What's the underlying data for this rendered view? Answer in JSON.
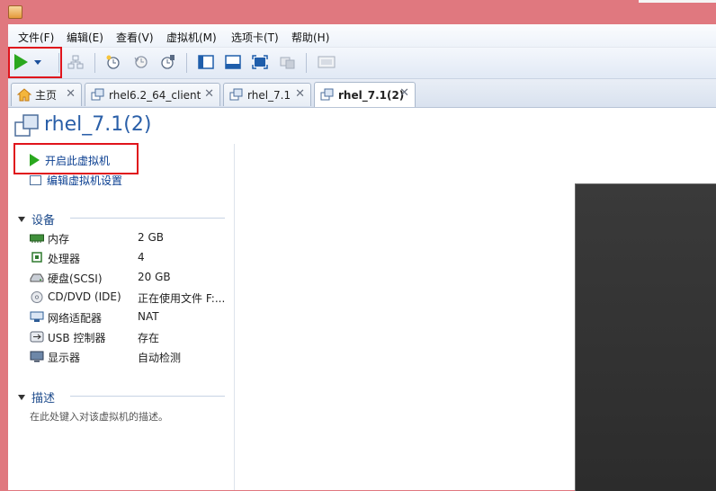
{
  "menu": [
    "文件(F)",
    "编辑(E)",
    "查看(V)",
    "虚拟机(M)",
    "选项卡(T)",
    "帮助(H)"
  ],
  "tabs": [
    {
      "label": "主页",
      "icon": "home-icon"
    },
    {
      "label": "rhel6.2_64_client",
      "icon": "vm-icon"
    },
    {
      "label": "rhel_7.1",
      "icon": "vm-icon"
    },
    {
      "label": "rhel_7.1(2)",
      "icon": "vm-icon",
      "active": true
    }
  ],
  "tab_close": "✕",
  "vm": {
    "title": "rhel_7.1(2)"
  },
  "actions": {
    "power_on": "开启此虚拟机",
    "edit_settings": "编辑虚拟机设置"
  },
  "devices": {
    "heading": "设备",
    "items": [
      {
        "name": "内存",
        "value": "2 GB",
        "icon": "memory-icon"
      },
      {
        "name": "处理器",
        "value": "4",
        "icon": "cpu-icon"
      },
      {
        "name": "硬盘(SCSI)",
        "value": "20 GB",
        "icon": "harddisk-icon"
      },
      {
        "name": "CD/DVD (IDE)",
        "value": "正在使用文件 F:...",
        "icon": "cd-icon"
      },
      {
        "name": "网络适配器",
        "value": "NAT",
        "icon": "network-icon"
      },
      {
        "name": "USB 控制器",
        "value": "存在",
        "icon": "usb-icon"
      },
      {
        "name": "显示器",
        "value": "自动检测",
        "icon": "monitor-icon"
      }
    ]
  },
  "description": {
    "heading": "描述",
    "placeholder": "在此处键入对该虚拟机的描述。"
  },
  "colors": {
    "accent": "#2a5fa8",
    "highlight_box": "#e0141c",
    "play": "#2aa81e"
  }
}
